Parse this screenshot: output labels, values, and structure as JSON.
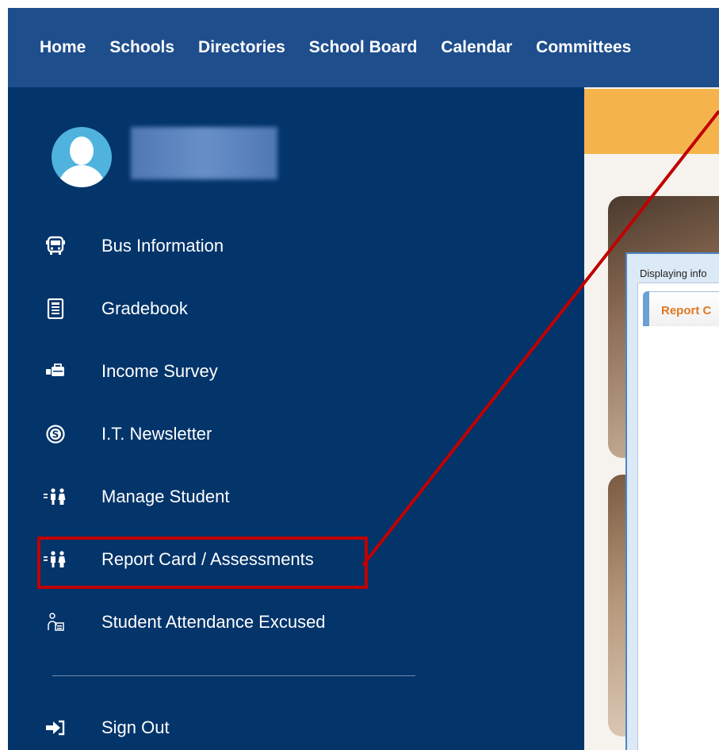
{
  "topnav": {
    "items": [
      "Home",
      "Schools",
      "Directories",
      "School Board",
      "Calendar",
      "Committees"
    ]
  },
  "sidebar": {
    "items": [
      {
        "label": "Bus Information",
        "icon": "bus-icon"
      },
      {
        "label": "Gradebook",
        "icon": "gradebook-icon"
      },
      {
        "label": "Income Survey",
        "icon": "income-survey-icon"
      },
      {
        "label": "I.T. Newsletter",
        "icon": "newsletter-icon"
      },
      {
        "label": "Manage Student",
        "icon": "students-icon"
      },
      {
        "label": "Report Card / Assessments",
        "icon": "students-icon"
      },
      {
        "label": "Student Attendance Excused",
        "icon": "attendance-icon"
      }
    ],
    "sign_out": {
      "label": "Sign Out",
      "icon": "sign-out-icon"
    }
  },
  "popup": {
    "status_text": "Displaying info",
    "tab_label": "Report C"
  },
  "colors": {
    "nav_bg": "#1f4e8d",
    "sidebar_bg": "#03346a",
    "highlight": "#c00000",
    "banner": "#f5b44b",
    "tab_text": "#e07820"
  }
}
